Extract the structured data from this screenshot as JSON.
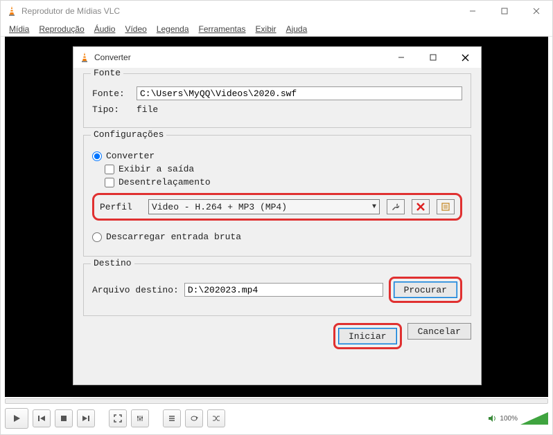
{
  "main_window": {
    "title": "Reprodutor de Mídias VLC",
    "menu": [
      "Mídia",
      "Reprodução",
      "Áudio",
      "Vídeo",
      "Legenda",
      "Ferramentas",
      "Exibir",
      "Ajuda"
    ],
    "volume_pct": "100%"
  },
  "dialog": {
    "title": "Converter",
    "source_group": {
      "title": "Fonte",
      "source_label": "Fonte:",
      "source_value": "C:\\Users\\MyQQ\\Videos\\2020.swf",
      "type_label": "Tipo:",
      "type_value": "file"
    },
    "settings_group": {
      "title": "Configurações",
      "convert_label": "Converter",
      "show_output_label": "Exibir a saída",
      "deinterlace_label": "Desentrelaçamento",
      "profile_label": "Perfil",
      "profile_value": "Video - H.264 + MP3 (MP4)",
      "dump_raw_label": "Descarregar entrada bruta"
    },
    "dest_group": {
      "title": "Destino",
      "dest_label": "Arquivo destino:",
      "dest_value": "D:\\202023.mp4",
      "browse_label": "Procurar"
    },
    "buttons": {
      "start": "Iniciar",
      "cancel": "Cancelar"
    }
  }
}
